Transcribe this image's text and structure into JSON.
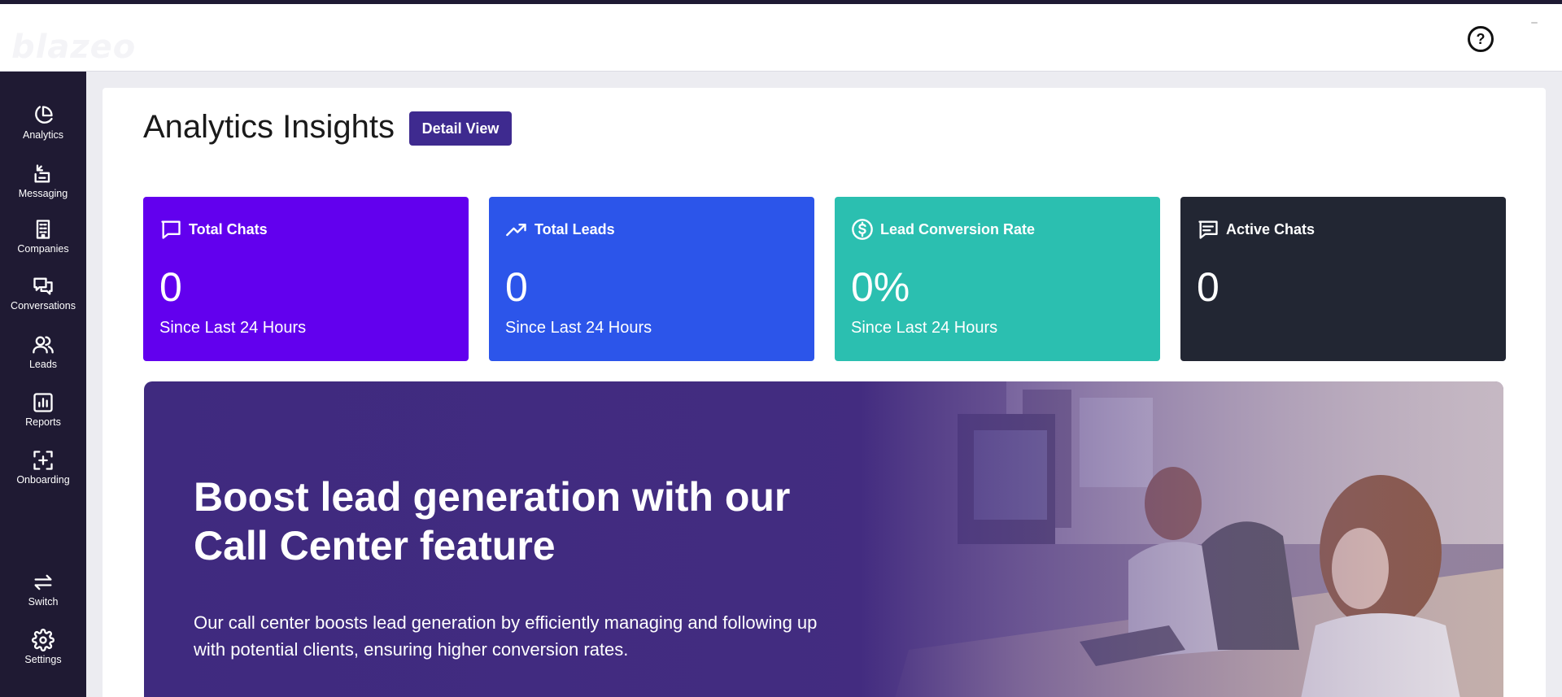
{
  "header": {
    "logo_text": "blazeo",
    "help_label": "?"
  },
  "sidebar": {
    "items": [
      {
        "label": "Analytics",
        "icon": "pie-chart-icon"
      },
      {
        "label": "Messaging",
        "icon": "message-arrow-icon"
      },
      {
        "label": "Companies",
        "icon": "building-icon"
      },
      {
        "label": "Conversations",
        "icon": "chat-bubbles-icon"
      },
      {
        "label": "Leads",
        "icon": "users-icon"
      },
      {
        "label": "Reports",
        "icon": "bar-chart-icon"
      },
      {
        "label": "Onboarding",
        "icon": "add-box-icon"
      }
    ],
    "bottom_items": [
      {
        "label": "Switch",
        "icon": "switch-arrows-icon"
      },
      {
        "label": "Settings",
        "icon": "gear-icon"
      }
    ]
  },
  "main": {
    "title": "Analytics Insights",
    "detail_view_label": "Detail View",
    "stats": [
      {
        "title": "Total Chats",
        "value": "0",
        "subtitle": "Since Last 24 Hours",
        "color": "#6200ee",
        "icon": "chat-square-icon"
      },
      {
        "title": "Total Leads",
        "value": "0",
        "subtitle": "Since Last 24 Hours",
        "color": "#2c55ea",
        "icon": "trending-up-icon"
      },
      {
        "title": "Lead Conversion Rate",
        "value": "0%",
        "subtitle": "Since Last 24 Hours",
        "color": "#2bbfb0",
        "icon": "dollar-circle-icon"
      },
      {
        "title": "Active Chats",
        "value": "0",
        "subtitle": "",
        "color": "#222633",
        "icon": "message-lines-icon"
      }
    ],
    "banner": {
      "title": "Boost lead generation with our Call Center feature",
      "text": "Our call center boosts lead generation by efficiently managing and following up with potential clients, ensuring higher conversion rates."
    }
  }
}
